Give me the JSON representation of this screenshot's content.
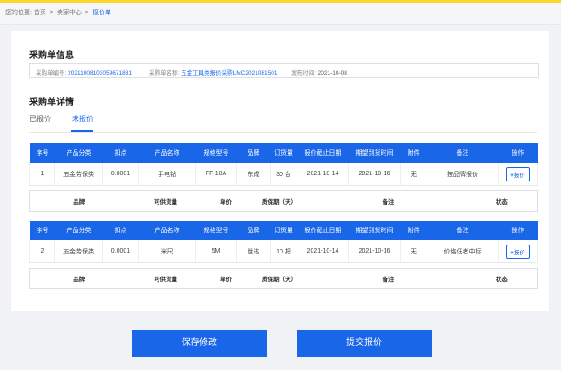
{
  "breadcrumb": {
    "prefix": "您的位置:",
    "home": "首页",
    "seller_center": "卖家中心",
    "current": "报价单",
    "separator": ">"
  },
  "info": {
    "title": "采购单信息",
    "order_no_label": "采购单编号:",
    "order_no": "20211008103059671881",
    "order_name_label": "采购单名称:",
    "order_name": "五金工具类报价采购LMC2021081501",
    "publish_label": "发布时间:",
    "publish_date": "2021-10-08"
  },
  "detail": {
    "title": "采购单详情",
    "tabs": [
      "已报价",
      "未报价"
    ],
    "active_tab": 1
  },
  "table_headers": [
    "序号",
    "产品分类",
    "扣点",
    "产品名称",
    "规格型号",
    "品牌",
    "订货量",
    "报价截止日期",
    "期望到货时间",
    "附件",
    "备注",
    "操作"
  ],
  "rows": [
    {
      "no": "1",
      "category": "五金劳保类",
      "rebate": "0.0001",
      "name": "手电钻",
      "model": "FF-10A",
      "brand": "东成",
      "qty": "30 台",
      "deadline": "2021-10-14",
      "expected": "2021-10-16",
      "attachment": "无",
      "remark": "按品牌报价",
      "action": "报价"
    },
    {
      "no": "2",
      "category": "五金劳保类",
      "rebate": "0.0001",
      "name": "米尺",
      "model": "5M",
      "brand": "世达",
      "qty": "10 把",
      "deadline": "2021-10-14",
      "expected": "2021-10-16",
      "attachment": "无",
      "remark": "价格低者中标",
      "action": "报价"
    }
  ],
  "supply_headers": [
    "品牌",
    "可供货量",
    "单价",
    "质保期（天）",
    "备注",
    "状态"
  ],
  "buttons": {
    "save": "保存修改",
    "submit": "提交报价"
  },
  "colors": {
    "accent": "#1a66e8",
    "top_strip": "#ffd42a"
  }
}
